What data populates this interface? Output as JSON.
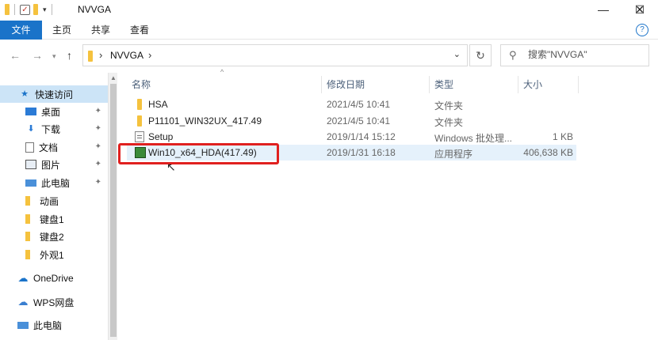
{
  "window": {
    "title": "NVVGA",
    "minimize": "—",
    "maximize": "☐",
    "close": "✕"
  },
  "ribbon": {
    "tabs": [
      "文件",
      "主页",
      "共享",
      "查看"
    ],
    "help": "?"
  },
  "address": {
    "path": [
      "NVVGA"
    ],
    "search_placeholder": "搜索\"NVVGA\""
  },
  "nav_pane": {
    "items": [
      {
        "label": "快速访问",
        "icon": "star-icon",
        "selected": true,
        "pinned": false
      },
      {
        "label": "桌面",
        "icon": "desktop-icon",
        "pinned": true
      },
      {
        "label": "下载",
        "icon": "download-icon",
        "pinned": true
      },
      {
        "label": "文档",
        "icon": "document-icon",
        "pinned": true
      },
      {
        "label": "图片",
        "icon": "picture-icon",
        "pinned": true
      },
      {
        "label": "此电脑",
        "icon": "computer-icon",
        "pinned": true
      },
      {
        "label": "动画",
        "icon": "folder-icon",
        "pinned": false
      },
      {
        "label": "键盘1",
        "icon": "folder-icon",
        "pinned": false
      },
      {
        "label": "键盘2",
        "icon": "folder-icon",
        "pinned": false
      },
      {
        "label": "外观1",
        "icon": "folder-icon",
        "pinned": false
      },
      {
        "label": "OneDrive",
        "icon": "cloud-icon",
        "pinned": false
      },
      {
        "label": "WPS网盘",
        "icon": "cloud-icon",
        "pinned": false
      },
      {
        "label": "此电脑",
        "icon": "computer-icon",
        "pinned": false
      }
    ]
  },
  "file_list": {
    "columns": [
      "名称",
      "修改日期",
      "类型",
      "大小"
    ],
    "rows": [
      {
        "name": "HSA",
        "modified": "2021/4/5 10:41",
        "type": "文件夹",
        "size": "",
        "icon": "folder-icon"
      },
      {
        "name": "P11101_WIN32UX_417.49",
        "modified": "2021/4/5 10:41",
        "type": "文件夹",
        "size": "",
        "icon": "folder-icon"
      },
      {
        "name": "Setup",
        "modified": "2019/1/14 15:12",
        "type": "Windows 批处理...",
        "size": "1 KB",
        "icon": "batch-file-icon"
      },
      {
        "name": "Win10_x64_HDA(417.49)",
        "modified": "2019/1/31 16:18",
        "type": "应用程序",
        "size": "406,638 KB",
        "icon": "application-icon",
        "highlighted": true
      }
    ]
  },
  "colors": {
    "accent": "#1a73c9",
    "highlight_box": "#e0201f",
    "selected_row": "#e5f1fb",
    "nav_selected": "#cce4f7"
  }
}
